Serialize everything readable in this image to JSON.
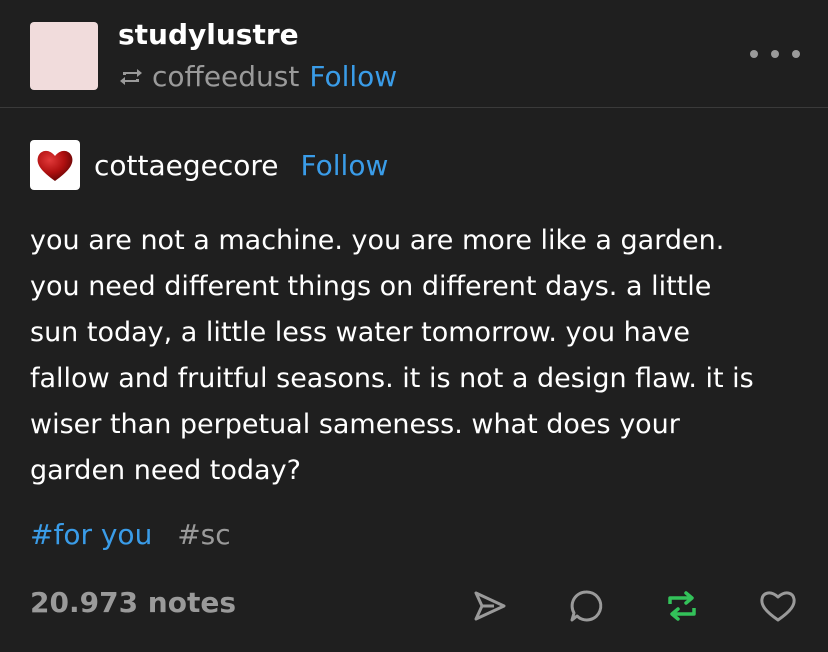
{
  "header": {
    "blog_name": "studylustre",
    "reblogged_from": "coffeedust",
    "follow_label": "Follow",
    "icons": [
      "reblog-icon",
      "more-options-icon"
    ]
  },
  "source": {
    "blog_name": "cottaegecore",
    "follow_label": "Follow",
    "avatar_icon": "heart-avatar"
  },
  "post": {
    "lines": [
      "you are not a machine. you are more like a garden.",
      "you need different things on different days. a little",
      "sun today, a little less water tomorrow. you have",
      "fallow and fruitful seasons. it is not a design flaw. it is",
      "wiser than perpetual sameness. what does your",
      "garden need today?"
    ],
    "tags": [
      "#for you",
      "#sc"
    ]
  },
  "footer": {
    "notes": "20.973 notes",
    "actions": [
      "share-icon",
      "reply-icon",
      "reblog-icon",
      "like-icon"
    ]
  },
  "colors": {
    "background": "#1f1f1f",
    "accent": "#3a9ce8",
    "muted": "#9a9a9a",
    "reblog_active": "#33c25a"
  }
}
